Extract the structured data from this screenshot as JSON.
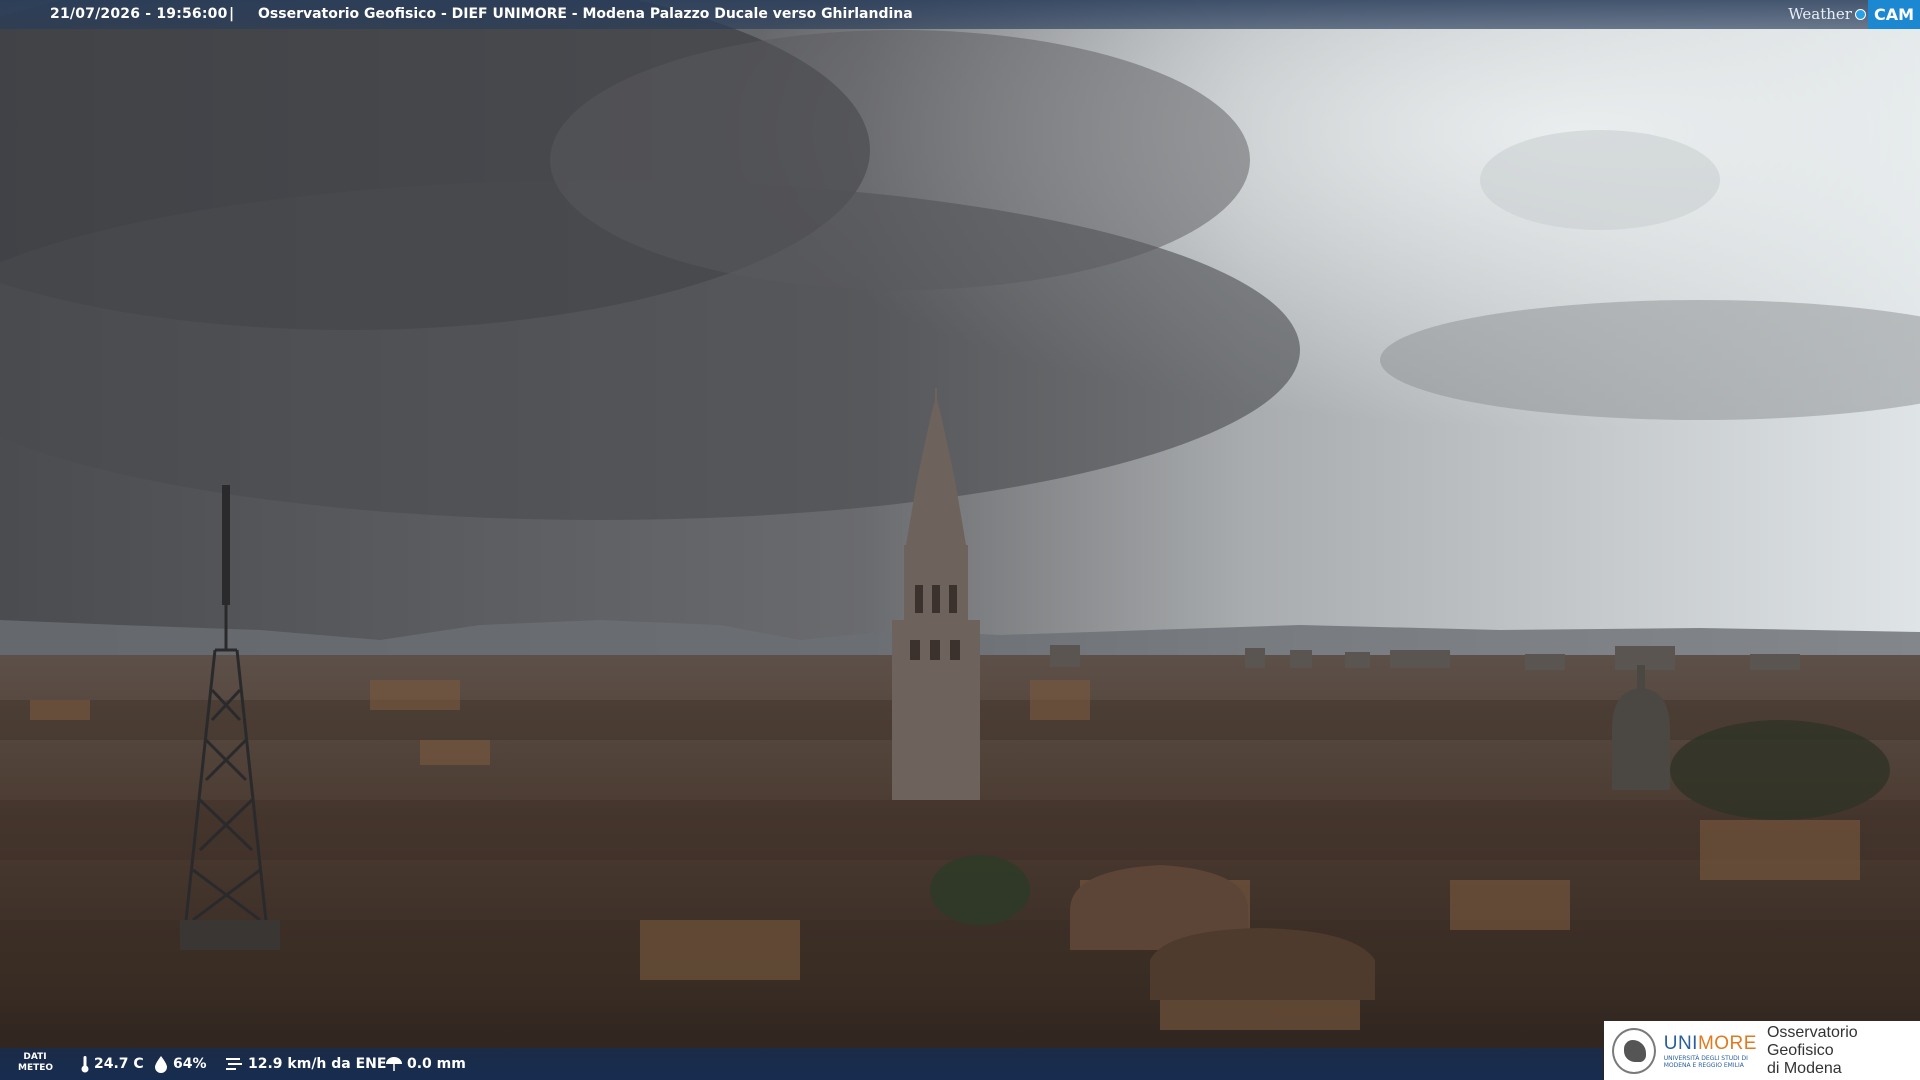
{
  "header": {
    "timestamp": "21/07/2026 - 19:56:00",
    "separator": "|",
    "title": "Osservatorio Geofisico - DIEF UNIMORE - Modena Palazzo Ducale verso Ghirlandina"
  },
  "brand": {
    "weather": "Weather",
    "cam": "CAM",
    "accent": "#1c88d2"
  },
  "meteo": {
    "label_line1": "DATI",
    "label_line2": "METEO",
    "temperature": "24.7 C",
    "humidity": "64%",
    "wind": "12.9 km/h da ENE",
    "rain": "0.0 mm"
  },
  "footer_logo": {
    "uni_prefix": "UNI",
    "uni_suffix": "MORE",
    "uni_sub1": "UNIVERSITÀ DEGLI STUDI DI",
    "uni_sub2": "MODENA E REGGIO EMILIA",
    "oss_line1": "Osservatorio Geofisico",
    "oss_line2": "di Modena"
  }
}
